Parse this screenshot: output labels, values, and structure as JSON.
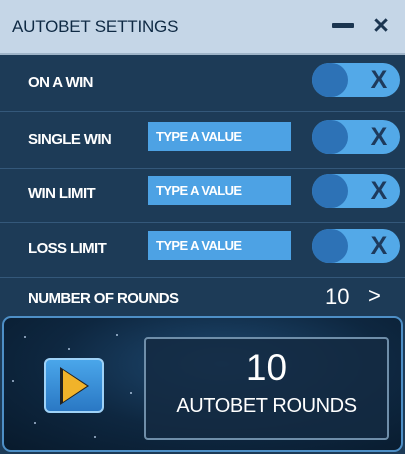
{
  "header": {
    "title": "AUTOBET SETTINGS",
    "minimize_icon": "minimize-icon",
    "close_label": "×"
  },
  "settings": {
    "on_a_win": {
      "label": "ON A WIN",
      "toggle_label": "X"
    },
    "single_win": {
      "label": "SINGLE WIN",
      "placeholder": "TYPE A VALUE",
      "value": "",
      "toggle_label": "X"
    },
    "win_limit": {
      "label": "WIN LIMIT",
      "placeholder": "TYPE A VALUE",
      "value": "",
      "toggle_label": "X"
    },
    "loss_limit": {
      "label": "LOSS LIMIT",
      "placeholder": "TYPE A VALUE",
      "value": "",
      "toggle_label": "X"
    }
  },
  "rounds": {
    "label": "NUMBER OF ROUNDS",
    "value": "10",
    "chevron": ">"
  },
  "autobet": {
    "count": "10",
    "label": "AUTOBET ROUNDS",
    "play_icon": "play-icon"
  },
  "colors": {
    "panel_background": "#1d3b57",
    "header_background": "#c5d6e7",
    "input_background": "#4da2e4",
    "toggle_track": "#53a9e8",
    "toggle_knob": "#2d72b6",
    "play_triangle": "#f1b32a"
  }
}
